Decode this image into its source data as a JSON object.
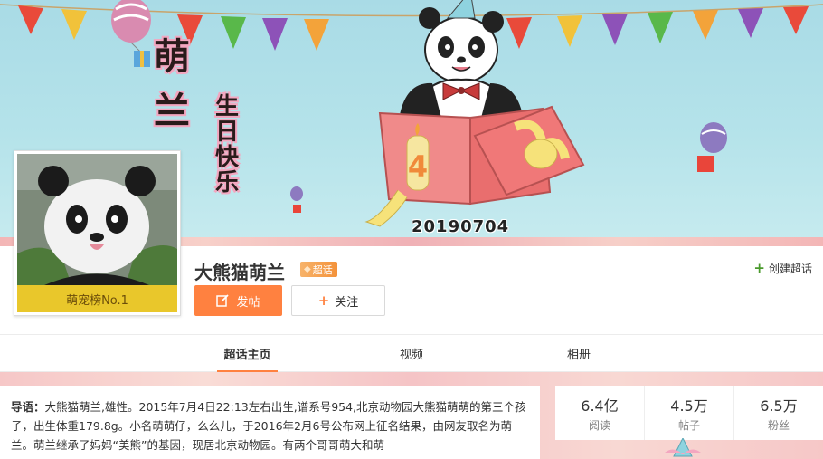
{
  "banner": {
    "title_line1": "萌",
    "title_line2": "兰",
    "greeting": "生日快乐",
    "date": "20190704",
    "cake_number": "4"
  },
  "avatar": {
    "rank_label": "萌宠榜No.1"
  },
  "header": {
    "title": "大熊猫萌兰",
    "badge_label": "超话",
    "create_link": "创建超话",
    "post_button": "发帖",
    "follow_button": "关注"
  },
  "tabs": [
    {
      "label": "超话主页",
      "active": true
    },
    {
      "label": "视频",
      "active": false
    },
    {
      "label": "相册",
      "active": false
    }
  ],
  "intro": {
    "label": "导语：",
    "text": "大熊猫萌兰,雄性。2015年7月4日22:13左右出生,谱系号954,北京动物园大熊猫萌萌的第三个孩子，出生体重179.8g。小名萌萌仔，么么儿，于2016年2月6号公布网上征名结果，由网友取名为萌兰。萌兰继承了妈妈“美熊”的基因，现居北京动物园。有两个哥哥萌大和萌"
  },
  "stats": [
    {
      "value": "6.4亿",
      "label": "阅读"
    },
    {
      "value": "4.5万",
      "label": "帖子"
    },
    {
      "value": "6.5万",
      "label": "粉丝"
    }
  ],
  "colors": {
    "accent": "#ff8140",
    "rank_bar": "#e9c72b",
    "banner_sky": "#a9dbe6"
  }
}
